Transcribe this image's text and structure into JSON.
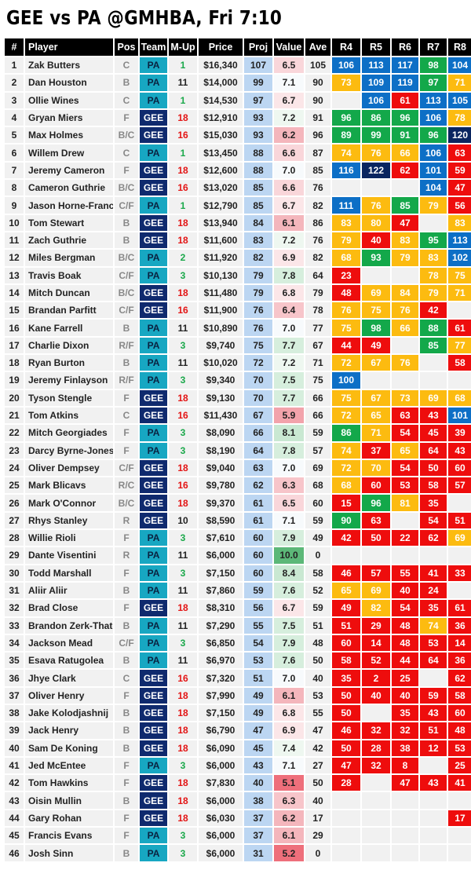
{
  "title": "GEE vs PA @GMHBA, Fri 7:10",
  "headers": [
    "#",
    "Player",
    "Pos",
    "Team",
    "M-Up",
    "Price",
    "Proj",
    "Value",
    "Ave",
    "R4",
    "R5",
    "R6",
    "R7",
    "R8"
  ],
  "colors": {
    "team_PA": "#17a7c2",
    "team_GEE": "#0f2a6e",
    "score_navy": "#0a2560",
    "score_blue": "#0d6fc6",
    "score_green": "#13a84a",
    "score_yellow": "#fcbb10",
    "score_red": "#ee0d0d",
    "proj_bg": "#bcd6f2",
    "mup_red": "#e31414",
    "mup_green": "#1aa84a"
  },
  "rows": [
    {
      "n": "1",
      "player": "Zak Butters",
      "pos": "C",
      "team": "PA",
      "mup": "1",
      "price": "$16,340",
      "proj": "107",
      "value": "6.5",
      "ave": "105",
      "r": [
        "106",
        "113",
        "117",
        "98",
        "104"
      ]
    },
    {
      "n": "2",
      "player": "Dan Houston",
      "pos": "B",
      "team": "PA",
      "mup": "11",
      "price": "$14,000",
      "proj": "99",
      "value": "7.1",
      "ave": "90",
      "r": [
        "73",
        "109",
        "119",
        "97",
        "71"
      ]
    },
    {
      "n": "3",
      "player": "Ollie Wines",
      "pos": "C",
      "team": "PA",
      "mup": "1",
      "price": "$14,530",
      "proj": "97",
      "value": "6.7",
      "ave": "90",
      "r": [
        "",
        "106",
        "61",
        "113",
        "105"
      ]
    },
    {
      "n": "4",
      "player": "Gryan Miers",
      "pos": "F",
      "team": "GEE",
      "mup": "18",
      "price": "$12,910",
      "proj": "93",
      "value": "7.2",
      "ave": "91",
      "r": [
        "96",
        "86",
        "96",
        "106",
        "78"
      ]
    },
    {
      "n": "5",
      "player": "Max Holmes",
      "pos": "B/C",
      "team": "GEE",
      "mup": "16",
      "price": "$15,030",
      "proj": "93",
      "value": "6.2",
      "ave": "96",
      "r": [
        "89",
        "99",
        "91",
        "96",
        "120"
      ]
    },
    {
      "n": "6",
      "player": "Willem Drew",
      "pos": "C",
      "team": "PA",
      "mup": "1",
      "price": "$13,450",
      "proj": "88",
      "value": "6.6",
      "ave": "87",
      "r": [
        "74",
        "76",
        "66",
        "106",
        "63"
      ]
    },
    {
      "n": "7",
      "player": "Jeremy Cameron",
      "pos": "F",
      "team": "GEE",
      "mup": "18",
      "price": "$12,600",
      "proj": "88",
      "value": "7.0",
      "ave": "85",
      "r": [
        "116",
        "122",
        "62",
        "101",
        "59"
      ]
    },
    {
      "n": "8",
      "player": "Cameron Guthrie",
      "pos": "B/C",
      "team": "GEE",
      "mup": "16",
      "price": "$13,020",
      "proj": "85",
      "value": "6.6",
      "ave": "76",
      "r": [
        "",
        "",
        "",
        "104",
        "47"
      ]
    },
    {
      "n": "9",
      "player": "Jason Horne-Franci",
      "pos": "C/F",
      "team": "PA",
      "mup": "1",
      "price": "$12,790",
      "proj": "85",
      "value": "6.7",
      "ave": "82",
      "r": [
        "111",
        "76",
        "85",
        "79",
        "56"
      ]
    },
    {
      "n": "10",
      "player": "Tom Stewart",
      "pos": "B",
      "team": "GEE",
      "mup": "18",
      "price": "$13,940",
      "proj": "84",
      "value": "6.1",
      "ave": "86",
      "r": [
        "83",
        "80",
        "47",
        "",
        "83"
      ]
    },
    {
      "n": "11",
      "player": "Zach Guthrie",
      "pos": "B",
      "team": "GEE",
      "mup": "18",
      "price": "$11,600",
      "proj": "83",
      "value": "7.2",
      "ave": "76",
      "r": [
        "79",
        "40",
        "83",
        "95",
        "113"
      ]
    },
    {
      "n": "12",
      "player": "Miles Bergman",
      "pos": "B/C",
      "team": "PA",
      "mup": "2",
      "price": "$11,920",
      "proj": "82",
      "value": "6.9",
      "ave": "82",
      "r": [
        "68",
        "93",
        "79",
        "83",
        "102"
      ]
    },
    {
      "n": "13",
      "player": "Travis Boak",
      "pos": "C/F",
      "team": "PA",
      "mup": "3",
      "price": "$10,130",
      "proj": "79",
      "value": "7.8",
      "ave": "64",
      "r": [
        "23",
        "",
        "",
        "78",
        "75"
      ]
    },
    {
      "n": "14",
      "player": "Mitch Duncan",
      "pos": "B/C",
      "team": "GEE",
      "mup": "18",
      "price": "$11,480",
      "proj": "79",
      "value": "6.8",
      "ave": "79",
      "r": [
        "48",
        "69",
        "84",
        "79",
        "71"
      ]
    },
    {
      "n": "15",
      "player": "Brandan Parfitt",
      "pos": "C/F",
      "team": "GEE",
      "mup": "16",
      "price": "$11,900",
      "proj": "76",
      "value": "6.4",
      "ave": "78",
      "r": [
        "76",
        "75",
        "76",
        "42",
        ""
      ]
    },
    {
      "n": "16",
      "player": "Kane Farrell",
      "pos": "B",
      "team": "PA",
      "mup": "11",
      "price": "$10,890",
      "proj": "76",
      "value": "7.0",
      "ave": "77",
      "r": [
        "75",
        "98",
        "66",
        "88",
        "61"
      ]
    },
    {
      "n": "17",
      "player": "Charlie Dixon",
      "pos": "R/F",
      "team": "PA",
      "mup": "3",
      "price": "$9,740",
      "proj": "75",
      "value": "7.7",
      "ave": "67",
      "r": [
        "44",
        "49",
        "",
        "85",
        "77"
      ]
    },
    {
      "n": "18",
      "player": "Ryan Burton",
      "pos": "B",
      "team": "PA",
      "mup": "11",
      "price": "$10,020",
      "proj": "72",
      "value": "7.2",
      "ave": "71",
      "r": [
        "72",
        "67",
        "76",
        "",
        "58"
      ]
    },
    {
      "n": "19",
      "player": "Jeremy Finlayson",
      "pos": "R/F",
      "team": "PA",
      "mup": "3",
      "price": "$9,340",
      "proj": "70",
      "value": "7.5",
      "ave": "75",
      "r": [
        "100",
        "",
        "",
        "",
        ""
      ]
    },
    {
      "n": "20",
      "player": "Tyson Stengle",
      "pos": "F",
      "team": "GEE",
      "mup": "18",
      "price": "$9,130",
      "proj": "70",
      "value": "7.7",
      "ave": "66",
      "r": [
        "75",
        "67",
        "73",
        "69",
        "68"
      ]
    },
    {
      "n": "21",
      "player": "Tom Atkins",
      "pos": "C",
      "team": "GEE",
      "mup": "16",
      "price": "$11,430",
      "proj": "67",
      "value": "5.9",
      "ave": "66",
      "r": [
        "72",
        "65",
        "63",
        "43",
        "101"
      ]
    },
    {
      "n": "22",
      "player": "Mitch Georgiades",
      "pos": "F",
      "team": "PA",
      "mup": "3",
      "price": "$8,090",
      "proj": "66",
      "value": "8.1",
      "ave": "59",
      "r": [
        "86",
        "71",
        "54",
        "45",
        "39"
      ]
    },
    {
      "n": "23",
      "player": "Darcy Byrne-Jones",
      "pos": "F",
      "team": "PA",
      "mup": "3",
      "price": "$8,190",
      "proj": "64",
      "value": "7.8",
      "ave": "57",
      "r": [
        "74",
        "37",
        "65",
        "64",
        "43"
      ]
    },
    {
      "n": "24",
      "player": "Oliver Dempsey",
      "pos": "C/F",
      "team": "GEE",
      "mup": "18",
      "price": "$9,040",
      "proj": "63",
      "value": "7.0",
      "ave": "69",
      "r": [
        "72",
        "70",
        "54",
        "50",
        "60"
      ]
    },
    {
      "n": "25",
      "player": "Mark Blicavs",
      "pos": "R/C",
      "team": "GEE",
      "mup": "16",
      "price": "$9,780",
      "proj": "62",
      "value": "6.3",
      "ave": "68",
      "r": [
        "68",
        "60",
        "53",
        "58",
        "57"
      ]
    },
    {
      "n": "26",
      "player": "Mark O'Connor",
      "pos": "B/C",
      "team": "GEE",
      "mup": "18",
      "price": "$9,370",
      "proj": "61",
      "value": "6.5",
      "ave": "60",
      "r": [
        "15",
        "96",
        "81",
        "35",
        ""
      ]
    },
    {
      "n": "27",
      "player": "Rhys Stanley",
      "pos": "R",
      "team": "GEE",
      "mup": "10",
      "price": "$8,590",
      "proj": "61",
      "value": "7.1",
      "ave": "59",
      "r": [
        "90",
        "63",
        "",
        "54",
        "51"
      ]
    },
    {
      "n": "28",
      "player": "Willie Rioli",
      "pos": "F",
      "team": "PA",
      "mup": "3",
      "price": "$7,610",
      "proj": "60",
      "value": "7.9",
      "ave": "49",
      "r": [
        "42",
        "50",
        "22",
        "62",
        "69"
      ]
    },
    {
      "n": "29",
      "player": "Dante Visentini",
      "pos": "R",
      "team": "PA",
      "mup": "11",
      "price": "$6,000",
      "proj": "60",
      "value": "10.0",
      "ave": "0",
      "r": [
        "",
        "",
        "",
        "",
        ""
      ]
    },
    {
      "n": "30",
      "player": "Todd Marshall",
      "pos": "F",
      "team": "PA",
      "mup": "3",
      "price": "$7,150",
      "proj": "60",
      "value": "8.4",
      "ave": "58",
      "r": [
        "46",
        "57",
        "55",
        "41",
        "33"
      ]
    },
    {
      "n": "31",
      "player": "Aliir Aliir",
      "pos": "B",
      "team": "PA",
      "mup": "11",
      "price": "$7,860",
      "proj": "59",
      "value": "7.6",
      "ave": "52",
      "r": [
        "65",
        "69",
        "40",
        "24",
        ""
      ]
    },
    {
      "n": "32",
      "player": "Brad Close",
      "pos": "F",
      "team": "GEE",
      "mup": "18",
      "price": "$8,310",
      "proj": "56",
      "value": "6.7",
      "ave": "59",
      "r": [
        "49",
        "82",
        "54",
        "35",
        "61"
      ]
    },
    {
      "n": "33",
      "player": "Brandon Zerk-Thatc",
      "pos": "B",
      "team": "PA",
      "mup": "11",
      "price": "$7,290",
      "proj": "55",
      "value": "7.5",
      "ave": "51",
      "r": [
        "51",
        "29",
        "48",
        "74",
        "36"
      ]
    },
    {
      "n": "34",
      "player": "Jackson Mead",
      "pos": "C/F",
      "team": "PA",
      "mup": "3",
      "price": "$6,850",
      "proj": "54",
      "value": "7.9",
      "ave": "48",
      "r": [
        "60",
        "14",
        "48",
        "53",
        "14"
      ]
    },
    {
      "n": "35",
      "player": "Esava Ratugolea",
      "pos": "B",
      "team": "PA",
      "mup": "11",
      "price": "$6,970",
      "proj": "53",
      "value": "7.6",
      "ave": "50",
      "r": [
        "58",
        "52",
        "44",
        "64",
        "36"
      ]
    },
    {
      "n": "36",
      "player": "Jhye Clark",
      "pos": "C",
      "team": "GEE",
      "mup": "16",
      "price": "$7,320",
      "proj": "51",
      "value": "7.0",
      "ave": "40",
      "r": [
        "35",
        "2",
        "25",
        "",
        "62"
      ]
    },
    {
      "n": "37",
      "player": "Oliver Henry",
      "pos": "F",
      "team": "GEE",
      "mup": "18",
      "price": "$7,990",
      "proj": "49",
      "value": "6.1",
      "ave": "53",
      "r": [
        "50",
        "40",
        "40",
        "59",
        "58"
      ]
    },
    {
      "n": "38",
      "player": "Jake Kolodjashnij",
      "pos": "B",
      "team": "GEE",
      "mup": "18",
      "price": "$7,150",
      "proj": "49",
      "value": "6.8",
      "ave": "55",
      "r": [
        "50",
        "",
        "35",
        "43",
        "60"
      ]
    },
    {
      "n": "39",
      "player": "Jack Henry",
      "pos": "B",
      "team": "GEE",
      "mup": "18",
      "price": "$6,790",
      "proj": "47",
      "value": "6.9",
      "ave": "47",
      "r": [
        "46",
        "32",
        "32",
        "51",
        "48"
      ]
    },
    {
      "n": "40",
      "player": "Sam De Koning",
      "pos": "B",
      "team": "GEE",
      "mup": "18",
      "price": "$6,090",
      "proj": "45",
      "value": "7.4",
      "ave": "42",
      "r": [
        "50",
        "28",
        "38",
        "12",
        "53"
      ]
    },
    {
      "n": "41",
      "player": "Jed McEntee",
      "pos": "F",
      "team": "PA",
      "mup": "3",
      "price": "$6,000",
      "proj": "43",
      "value": "7.1",
      "ave": "27",
      "r": [
        "47",
        "32",
        "8",
        "",
        "25"
      ]
    },
    {
      "n": "42",
      "player": "Tom Hawkins",
      "pos": "F",
      "team": "GEE",
      "mup": "18",
      "price": "$7,830",
      "proj": "40",
      "value": "5.1",
      "ave": "50",
      "r": [
        "28",
        "",
        "47",
        "43",
        "41"
      ]
    },
    {
      "n": "43",
      "player": "Oisin Mullin",
      "pos": "B",
      "team": "GEE",
      "mup": "18",
      "price": "$6,000",
      "proj": "38",
      "value": "6.3",
      "ave": "40",
      "r": [
        "",
        "",
        "",
        "",
        ""
      ]
    },
    {
      "n": "44",
      "player": "Gary Rohan",
      "pos": "F",
      "team": "GEE",
      "mup": "18",
      "price": "$6,030",
      "proj": "37",
      "value": "6.2",
      "ave": "17",
      "r": [
        "",
        "",
        "",
        "",
        "17"
      ]
    },
    {
      "n": "45",
      "player": "Francis Evans",
      "pos": "F",
      "team": "PA",
      "mup": "3",
      "price": "$6,000",
      "proj": "37",
      "value": "6.1",
      "ave": "29",
      "r": [
        "",
        "",
        "",
        "",
        ""
      ]
    },
    {
      "n": "46",
      "player": "Josh Sinn",
      "pos": "B",
      "team": "PA",
      "mup": "3",
      "price": "$6,000",
      "proj": "31",
      "value": "5.2",
      "ave": "0",
      "r": [
        "",
        "",
        "",
        "",
        ""
      ]
    }
  ]
}
